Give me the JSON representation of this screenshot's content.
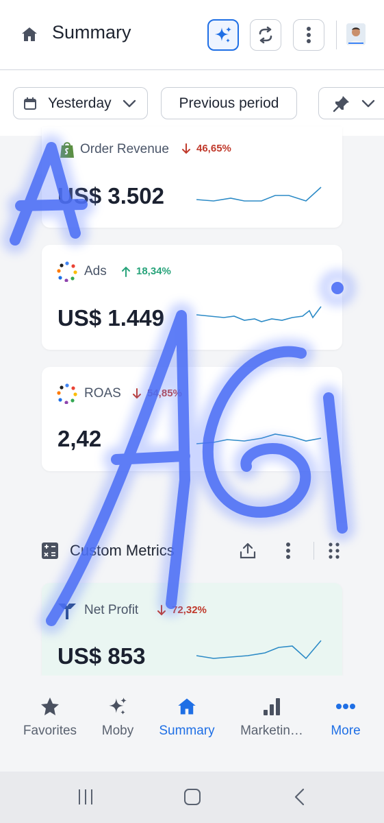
{
  "header": {
    "title": "Summary"
  },
  "filters": {
    "date_label": "Yesterday",
    "compare_label": "Previous period"
  },
  "cards": [
    {
      "title": "Order Revenue",
      "delta": "46,65%",
      "direction": "down",
      "value": "US$ 3.502",
      "icon": "shopify-icon"
    },
    {
      "title": "Ads",
      "delta": "18,34%",
      "direction": "up",
      "value": "US$ 1.449",
      "icon": "dots-ring-icon"
    },
    {
      "title": "ROAS",
      "delta": "54,85%",
      "direction": "down",
      "value": "2,42",
      "icon": "dots-ring-icon"
    },
    {
      "title": "Net Profit",
      "delta": "72,32%",
      "direction": "down",
      "value": "US$ 853",
      "icon": "triple-whale-icon"
    }
  ],
  "custom_metrics": {
    "title": "Custom Metrics"
  },
  "bottom_nav": {
    "items": [
      {
        "label": "Favorites",
        "icon": "star-icon"
      },
      {
        "label": "Moby",
        "icon": "sparkles-icon"
      },
      {
        "label": "Summary",
        "icon": "home-icon",
        "active": true
      },
      {
        "label": "Marketin…",
        "icon": "bar-chart-icon"
      },
      {
        "label": "More",
        "icon": "more-dots-icon"
      }
    ]
  },
  "overlay_text": "AGI",
  "colors": {
    "accent": "#1f6fe5",
    "down": "#c0392b",
    "up": "#27a37a",
    "spark_dark": "#2b6cb0",
    "spark_light": "#2ec4b6",
    "scribble": "#4b6ef5"
  }
}
